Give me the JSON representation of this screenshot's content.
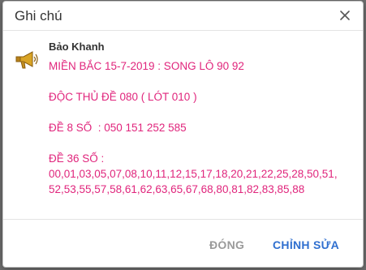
{
  "dialog": {
    "title": "Ghi chú",
    "author": "Bảo Khanh",
    "note_lines": [
      "MIỀN BẮC 15-7-2019 : SONG LÔ 90 92",
      "",
      "ĐỘC THỦ ĐỀ 080 ( LÓT 010 )",
      "",
      "ĐỀ 8 SỐ  : 050 151 252 585",
      "",
      "ĐỀ 36 SỐ :",
      "00,01,03,05,07,08,10,11,12,15,17,18,20,21,22,25,28,50,51,",
      "52,53,55,57,58,61,62,63,65,67,68,80,81,82,83,85,88"
    ],
    "buttons": {
      "close_label": "ĐÓNG",
      "edit_label": "CHỈNH SỬA"
    },
    "icons": {
      "close": "close-icon",
      "author": "megaphone-icon"
    },
    "colors": {
      "note_text": "#e0257c",
      "primary_button": "#2f6fcf",
      "secondary_button": "#9a9a9a"
    }
  }
}
